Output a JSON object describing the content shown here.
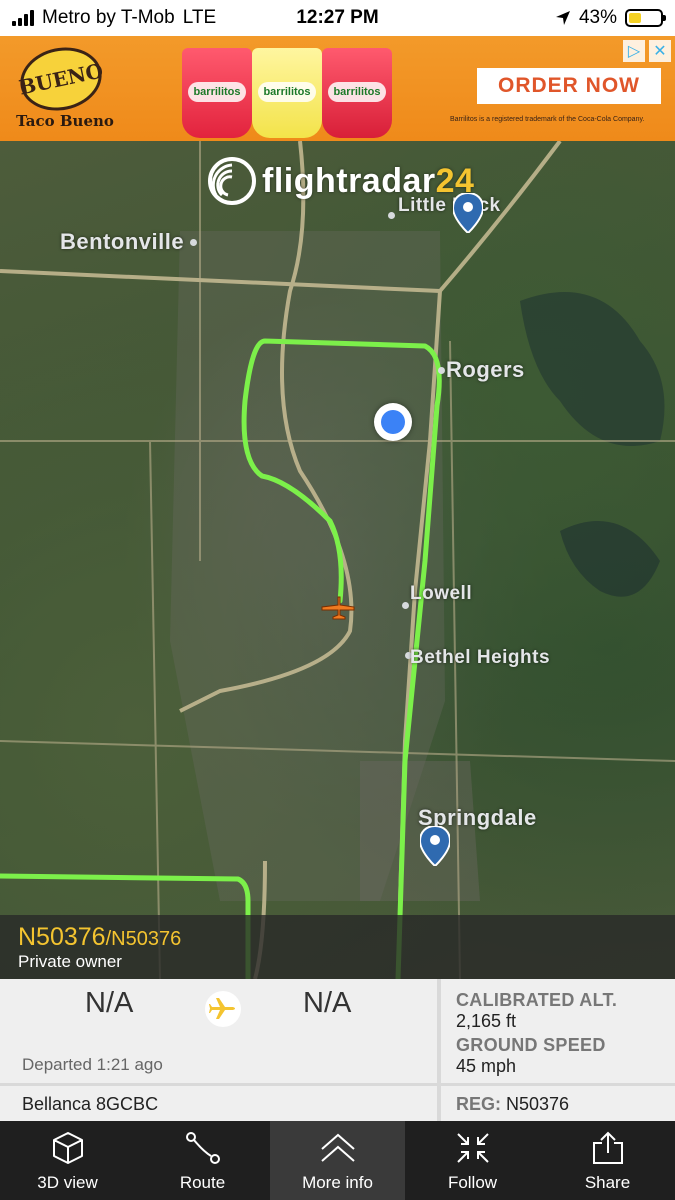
{
  "status_bar": {
    "carrier": "Metro by T-Mob",
    "network": "LTE",
    "time": "12:27 PM",
    "battery": "43%",
    "battery_level": 0.43
  },
  "ad": {
    "brand": "Taco Bueno",
    "logo_text": "BUENO",
    "product_label": "barrilitos",
    "cta": "ORDER NOW",
    "legal": "Barrilitos is a registered trademark of the Coca-Cola Company."
  },
  "map": {
    "logo": {
      "name": "flightradar",
      "number": "24"
    },
    "cities": [
      "Little Rock",
      "Bentonville",
      "Rogers",
      "Lowell",
      "Bethel Heights",
      "Springdale"
    ]
  },
  "flight": {
    "callsign": "N50376",
    "registration_sub": "/N50376",
    "owner": "Private owner",
    "origin": "N/A",
    "destination": "N/A",
    "departed": "Departed 1:21 ago",
    "calibrated_alt_label": "CALIBRATED ALT.",
    "calibrated_alt": "2,165 ft",
    "ground_speed_label": "GROUND SPEED",
    "ground_speed": "45 mph",
    "aircraft": "Bellanca 8GCBC",
    "reg_label": "REG:",
    "reg": "N50376"
  },
  "toolbar": [
    {
      "label": "3D view",
      "icon": "cube-icon"
    },
    {
      "label": "Route",
      "icon": "route-icon"
    },
    {
      "label": "More info",
      "icon": "chevron-up-icon",
      "active": true
    },
    {
      "label": "Follow",
      "icon": "follow-icon"
    },
    {
      "label": "Share",
      "icon": "share-icon"
    }
  ],
  "colors": {
    "track": "#7cf04a",
    "accent": "#f4c430",
    "plane": "#f07a20"
  }
}
